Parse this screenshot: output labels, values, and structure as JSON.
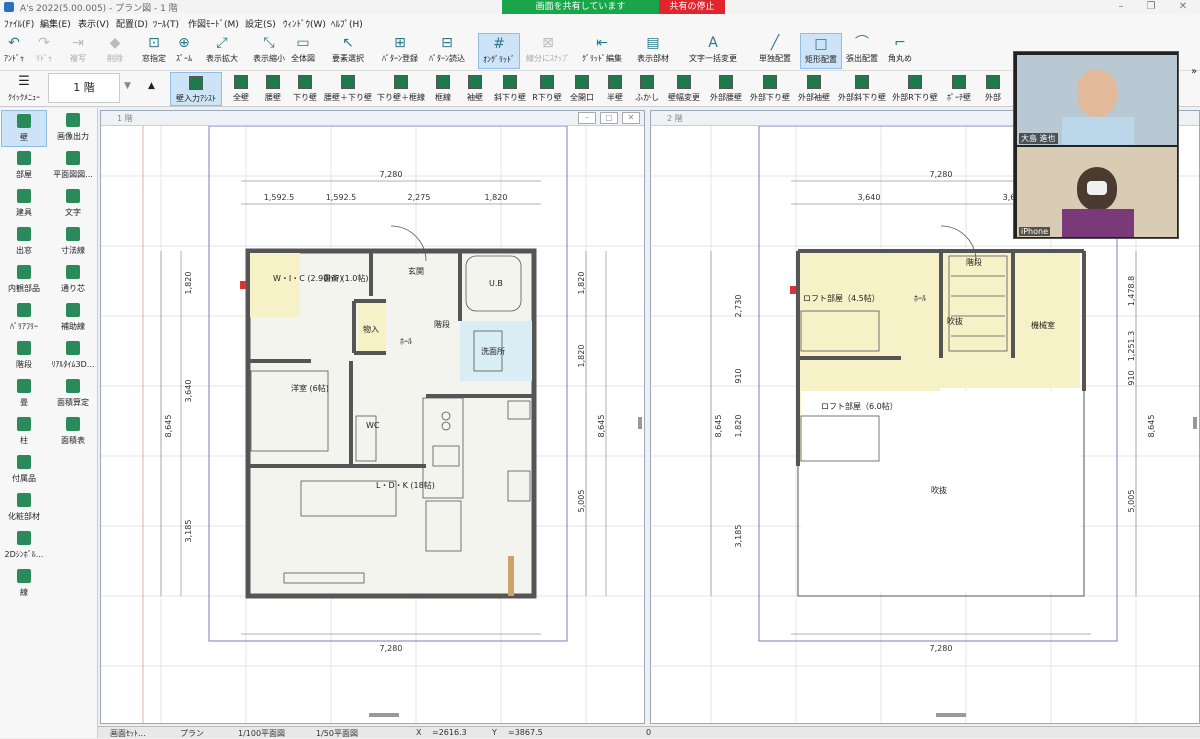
{
  "app": {
    "title": "A's 2022(5.00.005) - プラン図 - 1 階",
    "share_label": "画面を共有しています",
    "stop_label": "共有の停止"
  },
  "menu": [
    "ﾌｧｲﾙ(F)",
    "編集(E)",
    "表示(V)",
    "配置(D)",
    "ﾂｰﾙ(T)",
    "作図ﾓｰﾄﾞ(M)",
    "設定(S)",
    "ｳｨﾝﾄﾞｳ(W)",
    "ﾍﾙﾌﾟ(H)"
  ],
  "toolbar": [
    "ｱﾝﾄﾞｩ",
    "ﾘﾄﾞｩ",
    "複写",
    "削除",
    "窓指定",
    "ｽﾞｰﾑ",
    "表示拡大",
    "表示縮小",
    "全体図",
    "要素選択",
    "ﾊﾟﾀｰﾝ登録",
    "ﾊﾟﾀｰﾝ読込",
    "ｵﾝｸﾞﾘｯﾄﾞ",
    "線分にｽﾅｯﾌﾟ",
    "ｸﾞﾘｯﾄﾞ編集",
    "表示部材",
    "文字一括変更",
    "単独配置",
    "矩形配置",
    "張出配置",
    "角丸め"
  ],
  "toolbar_icons": [
    "↶",
    "↷",
    "⇥",
    "◆",
    "⊡",
    "⊕",
    "⤢",
    "⤡",
    "▭",
    "↖",
    "⊞",
    "⊟",
    "#",
    "⊠",
    "⇤",
    "▤",
    "A",
    "╱",
    "□",
    "⌒",
    "⌐"
  ],
  "toolbar2": {
    "quick_menu": "ｸｲｯｸﾒﾆｭｰ",
    "floor": "1 階",
    "wall_assist": "壁入力ｱｼｽﾄ",
    "items": [
      "全壁",
      "腰壁",
      "下り壁",
      "腰壁＋下り壁",
      "下り壁＋框線",
      "框線",
      "袖壁",
      "斜下り壁",
      "R下り壁",
      "全開口",
      "半壁",
      "ふかし",
      "壁幅変更",
      "外部腰壁",
      "外部下り壁",
      "外部袖壁",
      "外部斜下り壁",
      "外部R下り壁",
      "ﾎﾟｰﾁ壁",
      "外部"
    ]
  },
  "sidebar": [
    [
      "壁",
      "画像出力"
    ],
    [
      "部屋",
      "平面図図..."
    ],
    [
      "建具",
      "文字"
    ],
    [
      "出窓",
      "寸法線"
    ],
    [
      "内観部品",
      "通り芯"
    ],
    [
      "ﾊﾞﾘｱﾌﾘｰ",
      "補助線"
    ],
    [
      "階段",
      "ﾘｱﾙﾀｲﾑ3D..."
    ],
    [
      "畳",
      "面積算定"
    ],
    [
      "柱",
      "面積表"
    ],
    [
      "付属品",
      ""
    ],
    [
      "化粧部材",
      ""
    ],
    [
      "2Dｼﾝﾎﾞﾙ...",
      ""
    ],
    [
      "線",
      ""
    ]
  ],
  "pane1": {
    "title": "1 階",
    "dims_top_total": "7,280",
    "dims_top": [
      "1,592.5",
      "1,592.5",
      "2,275",
      "1,820"
    ],
    "dims_bottom": "7,280",
    "dims_left": [
      "1,820",
      "3,640",
      "3,185"
    ],
    "dims_left_total": "8,645",
    "dims_right": [
      "1,820",
      "1,820",
      "5,005"
    ],
    "dims_right_total": "8,645",
    "rooms": [
      "W・I・C\n(2.90m²)",
      "書斎\n(1.0帖)",
      "玄関",
      "U.B",
      "物入",
      "ﾎｰﾙ",
      "階段",
      "洗面所",
      "洋室\n(6帖)",
      "WC",
      "L・D・K\n(18帖)"
    ]
  },
  "pane2": {
    "title": "2 階",
    "dims_top_total": "7,280",
    "dims_top": [
      "3,640",
      "3,6"
    ],
    "dims_bottom": "7,280",
    "dims_left": [
      "2,730",
      "910",
      "1,820",
      "3,185"
    ],
    "dims_left_total": "8,645",
    "dims_right": [
      "1,478.8",
      "1,251.3",
      "910",
      "5,005"
    ],
    "dims_right_total": "8,645",
    "rooms": [
      "階段",
      "ロフト部屋（4.5帖）",
      "ﾎｰﾙ",
      "吹抜",
      "機械室",
      "ロフト部屋（6.0帖）",
      "吹抜"
    ]
  },
  "video": {
    "person1": "大島 進也",
    "person2": "iPhone"
  },
  "status": [
    "画面ｾｯﾄ...",
    "プラン",
    "1/100平面図",
    "1/50平面図",
    "X",
    "=2616.3",
    "Y",
    "=3867.5",
    "0"
  ],
  "colors": {
    "accent": "#1e7a4a",
    "select": "#cde3f7",
    "room_fill": "#f6f1c7",
    "wall": "#555555"
  }
}
